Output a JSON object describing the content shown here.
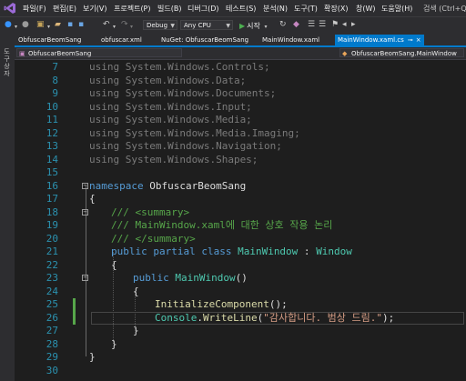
{
  "menu": {
    "items": [
      "파일(F)",
      "편집(E)",
      "보기(V)",
      "프로젝트(P)",
      "빌드(B)",
      "디버그(D)",
      "테스트(S)",
      "분석(N)",
      "도구(T)",
      "확장(X)",
      "창(W)",
      "도움말(H)"
    ],
    "search_text": "검색 (Ctrl+Q)"
  },
  "toolbar": {
    "config_value": "Debug",
    "platform_value": "Any CPU",
    "start_label": "시작"
  },
  "side_panel": {
    "label": "도구 상자"
  },
  "tabs": [
    "ObfuscarBeomSang",
    "obfuscar.xml",
    "NuGet: ObfuscarBeomSang",
    "MainWindow.xaml",
    "MainWindow.xaml.cs"
  ],
  "active_tab_index": 4,
  "navbar": {
    "project": "ObfuscarBeomSang",
    "member": "ObfuscarBeomSang.MainWindow"
  },
  "code_lines": [
    {
      "n": "7",
      "tokens": [
        {
          "c": "dim",
          "t": "using System.Windows.Controls;"
        }
      ]
    },
    {
      "n": "8",
      "tokens": [
        {
          "c": "dim",
          "t": "using System.Windows.Data;"
        }
      ]
    },
    {
      "n": "9",
      "tokens": [
        {
          "c": "dim",
          "t": "using System.Windows.Documents;"
        }
      ]
    },
    {
      "n": "10",
      "tokens": [
        {
          "c": "dim",
          "t": "using System.Windows.Input;"
        }
      ]
    },
    {
      "n": "11",
      "tokens": [
        {
          "c": "dim",
          "t": "using System.Windows.Media;"
        }
      ]
    },
    {
      "n": "12",
      "tokens": [
        {
          "c": "dim",
          "t": "using System.Windows.Media.Imaging;"
        }
      ]
    },
    {
      "n": "13",
      "tokens": [
        {
          "c": "dim",
          "t": "using System.Windows.Navigation;"
        }
      ]
    },
    {
      "n": "14",
      "tokens": [
        {
          "c": "dim",
          "t": "using System.Windows.Shapes;"
        }
      ]
    },
    {
      "n": "15",
      "tokens": []
    },
    {
      "n": "16",
      "tokens": [
        {
          "c": "kw",
          "t": "namespace"
        },
        {
          "c": "pl",
          "t": " ObfuscarBeomSang"
        }
      ]
    },
    {
      "n": "17",
      "tokens": [
        {
          "c": "pl",
          "t": "{"
        }
      ]
    },
    {
      "n": "18",
      "tokens": [
        {
          "c": "cm",
          "t": "/// <summary>"
        }
      ]
    },
    {
      "n": "19",
      "tokens": [
        {
          "c": "cm",
          "t": "/// MainWindow.xaml에 대한 상호 작용 논리"
        }
      ]
    },
    {
      "n": "20",
      "tokens": [
        {
          "c": "cm",
          "t": "/// </summary>"
        }
      ]
    },
    {
      "n": "21",
      "tokens": [
        {
          "c": "kw",
          "t": "public partial class "
        },
        {
          "c": "ty",
          "t": "MainWindow"
        },
        {
          "c": "pl",
          "t": " : "
        },
        {
          "c": "ty",
          "t": "Window"
        }
      ]
    },
    {
      "n": "22",
      "tokens": [
        {
          "c": "pl",
          "t": "{"
        }
      ]
    },
    {
      "n": "23",
      "tokens": [
        {
          "c": "kw",
          "t": "public "
        },
        {
          "c": "ty",
          "t": "MainWindow"
        },
        {
          "c": "pl",
          "t": "()"
        }
      ]
    },
    {
      "n": "24",
      "tokens": [
        {
          "c": "pl",
          "t": "{"
        }
      ]
    },
    {
      "n": "25",
      "tokens": [
        {
          "c": "mt",
          "t": "InitializeComponent"
        },
        {
          "c": "pl",
          "t": "();"
        }
      ]
    },
    {
      "n": "26",
      "tokens": [
        {
          "c": "ty",
          "t": "Console"
        },
        {
          "c": "pl",
          "t": "."
        },
        {
          "c": "mt",
          "t": "WriteLine"
        },
        {
          "c": "pl",
          "t": "("
        },
        {
          "c": "st",
          "t": "\"감사합니다. 범상 드림.\""
        },
        {
          "c": "pl",
          "t": ");"
        }
      ]
    },
    {
      "n": "27",
      "tokens": [
        {
          "c": "pl",
          "t": "}"
        }
      ]
    },
    {
      "n": "28",
      "tokens": [
        {
          "c": "pl",
          "t": "}"
        }
      ]
    },
    {
      "n": "29",
      "tokens": [
        {
          "c": "pl",
          "t": "}"
        }
      ]
    },
    {
      "n": "30",
      "tokens": []
    }
  ],
  "colors": {
    "accent": "#007acc",
    "keyword": "#569cd6",
    "type": "#4ec9b0",
    "comment": "#57a64a",
    "string": "#d69d85",
    "method": "#dcdcaa",
    "line_number": "#2b91af",
    "editor_bg": "#1e1e1e"
  }
}
